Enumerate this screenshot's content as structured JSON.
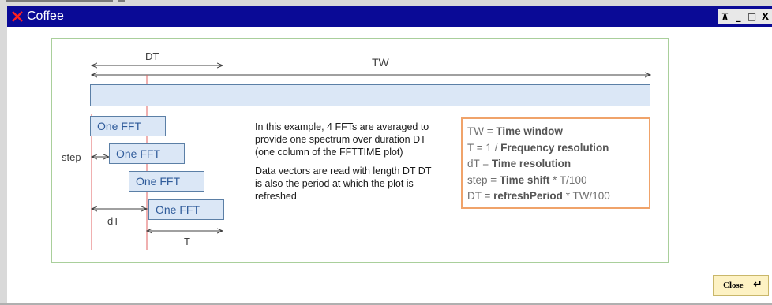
{
  "window": {
    "title": "Coffee",
    "controls": [
      "pin-icon",
      "minimize-icon",
      "maximize-icon",
      "close-icon"
    ],
    "control_glyphs": {
      "pin": "⊼",
      "minimize": "_",
      "maximize": "□",
      "close": "X"
    }
  },
  "diagram": {
    "dt_label": "DT",
    "tw_label": "TW",
    "step_label": "step",
    "small_dt_label": "dT",
    "t_label": "T",
    "fft_blocks": [
      "One FFT",
      "One FFT",
      "One FFT",
      "One FFT"
    ],
    "description": [
      "In this example, 4 FFTs are averaged to provide one spectrum over duration DT (one column of the FFTTIME plot)",
      "Data vectors are read with length DT DT is also the period at which the plot is refreshed"
    ],
    "legend": [
      {
        "prefix": "TW = ",
        "bold": "Time window",
        "suffix": ""
      },
      {
        "prefix": "T = 1 / ",
        "bold": "Frequency resolution",
        "suffix": ""
      },
      {
        "prefix": "dT = ",
        "bold": "Time resolution",
        "suffix": ""
      },
      {
        "prefix": "step = ",
        "bold": "Time shift",
        "suffix": " * T/100"
      },
      {
        "prefix": "DT = ",
        "bold": "refreshPeriod",
        "suffix": " * TW/100"
      }
    ],
    "colors": {
      "fft_fill": "#dbe7f6",
      "fft_border": "#5b7fa6",
      "red_line": "#e06060",
      "legend_border": "#f0a36a",
      "frame_border": "#a9cf9b"
    }
  },
  "footer": {
    "close_label": "Close",
    "close_icon": "↵"
  }
}
